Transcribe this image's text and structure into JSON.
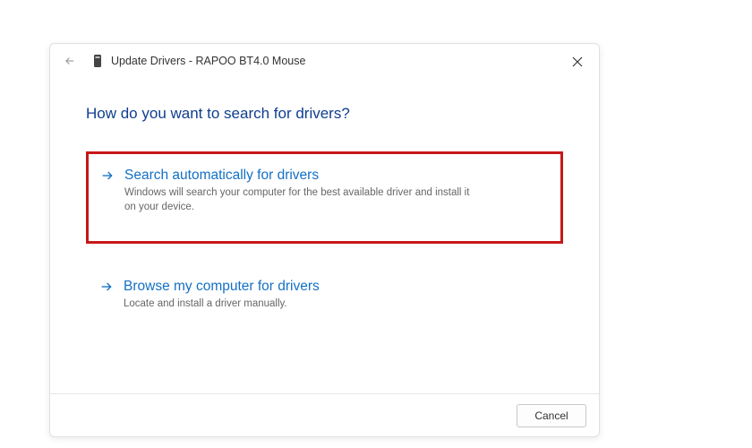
{
  "dialog": {
    "title": "Update Drivers - RAPOO BT4.0 Mouse",
    "heading": "How do you want to search for drivers?",
    "options": [
      {
        "title": "Search automatically for drivers",
        "description": "Windows will search your computer for the best available driver and install it on your device."
      },
      {
        "title": "Browse my computer for drivers",
        "description": "Locate and install a driver manually."
      }
    ],
    "cancel_label": "Cancel"
  }
}
